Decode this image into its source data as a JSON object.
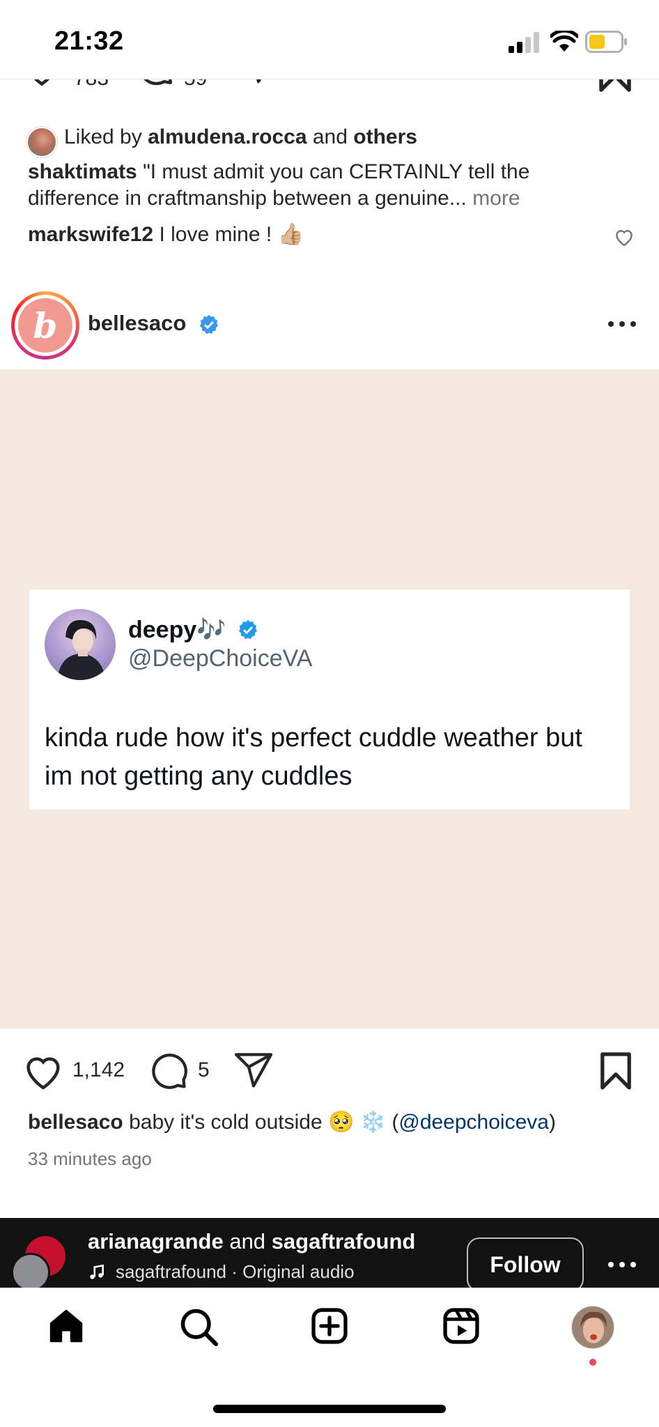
{
  "status_bar": {
    "time": "21:32"
  },
  "prev_post": {
    "likes": "783",
    "comments": "59",
    "liked_by_prefix": "Liked by",
    "liked_by_user": "almudena.rocca",
    "liked_by_and": "and",
    "liked_by_others": "others",
    "caption_user": "shaktimats",
    "caption_line1": "\"I must admit you can CERTAINLY tell the",
    "caption_line2": "difference in craftmanship between a genuine...",
    "more_label": "more",
    "comment_user": "markswife12",
    "comment_text": "I love mine ! 👍🏼"
  },
  "post": {
    "username": "bellesaco",
    "avatar_letter": "b",
    "tweet": {
      "name": "deepy🎶",
      "handle": "@DeepChoiceVA",
      "line1": "kinda rude how it's perfect cuddle weather but",
      "line2": "im not getting any cuddles"
    },
    "likes": "1,142",
    "comments": "5",
    "caption_user": "bellesaco",
    "caption_text": "baby it's cold outside 🥺 ❄️ (",
    "caption_mention": "@deepchoiceva",
    "caption_close": ")",
    "time_ago": "33 minutes ago"
  },
  "suggested_reel": {
    "user1": "arianagrande",
    "and_label": "and",
    "user2": "sagaftrafound",
    "audio": "sagaftrafound · Original audio",
    "follow_label": "Follow"
  },
  "colors": {
    "verified": "#3897f0",
    "notification_dot": "#ed4956",
    "media_bg": "#f5e9e1"
  }
}
